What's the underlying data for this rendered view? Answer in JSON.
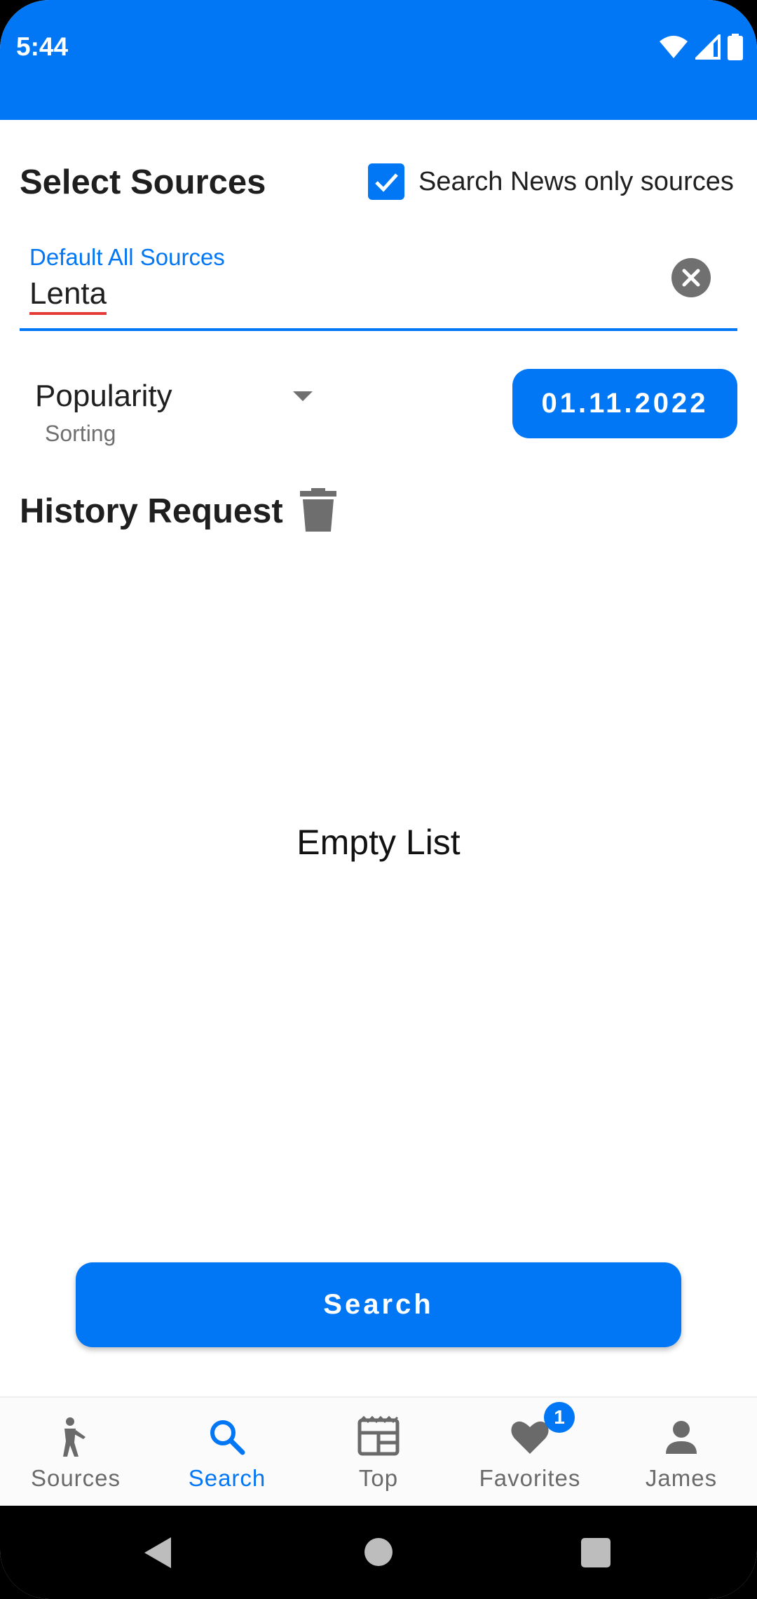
{
  "status_bar": {
    "time": "5:44"
  },
  "sources": {
    "title": "Select Sources",
    "checkbox_label": "Search News only sources",
    "checkbox_checked": true,
    "field_label": "Default All Sources",
    "field_value": "Lenta"
  },
  "sort": {
    "value": "Popularity",
    "caption": "Sorting"
  },
  "date_button": "01.11.2022",
  "history": {
    "title": "History Request",
    "empty_text": "Empty List"
  },
  "search_button": "Search",
  "nav": {
    "items": [
      {
        "label": "Sources",
        "icon": "person-icon",
        "active": false
      },
      {
        "label": "Search",
        "icon": "search-icon",
        "active": true
      },
      {
        "label": "Top",
        "icon": "newspaper-icon",
        "active": false
      },
      {
        "label": "Favorites",
        "icon": "heart-icon",
        "active": false,
        "badge": "1"
      },
      {
        "label": "James",
        "icon": "account-icon",
        "active": false
      }
    ]
  },
  "colors": {
    "primary": "#0277f5",
    "text": "#1f1f1f",
    "muted": "#707070"
  }
}
